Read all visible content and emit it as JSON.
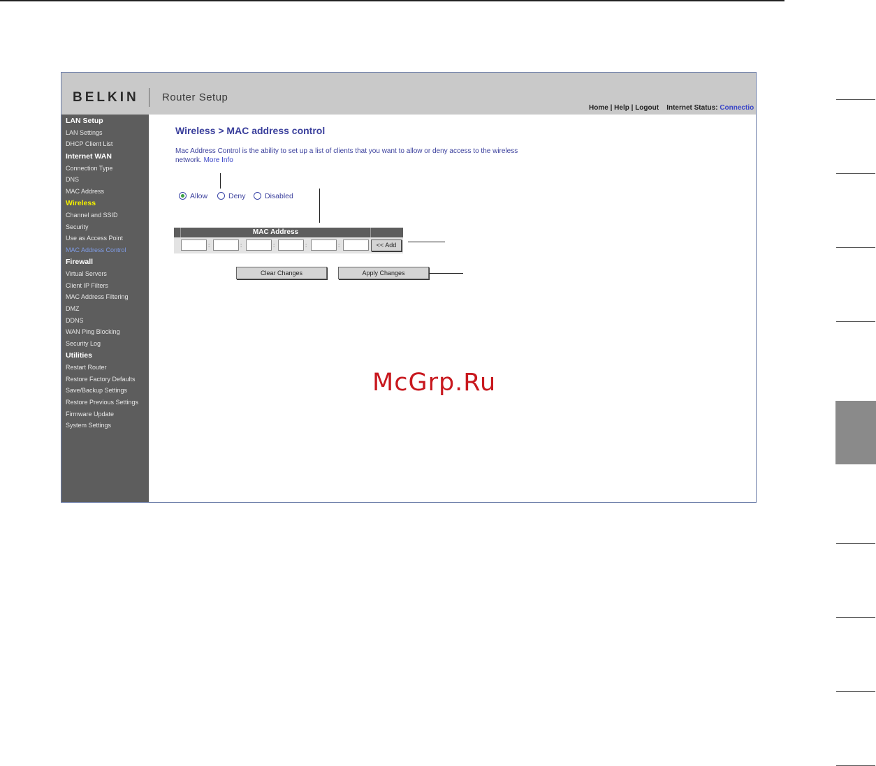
{
  "header": {
    "logo": "BELKIN",
    "title": "Router Setup",
    "links": {
      "home": "Home",
      "help": "Help",
      "logout": "Logout",
      "sep": " | "
    },
    "status_label": "Internet Status:",
    "status_value": "Connectio"
  },
  "sidebar": {
    "items": [
      {
        "label": "LAN Setup",
        "type": "head"
      },
      {
        "label": "LAN Settings",
        "type": "link"
      },
      {
        "label": "DHCP Client List",
        "type": "link"
      },
      {
        "label": "Internet WAN",
        "type": "head"
      },
      {
        "label": "Connection Type",
        "type": "link"
      },
      {
        "label": "DNS",
        "type": "link"
      },
      {
        "label": "MAC Address",
        "type": "link"
      },
      {
        "label": "Wireless",
        "type": "head-active"
      },
      {
        "label": "Channel and SSID",
        "type": "link"
      },
      {
        "label": "Security",
        "type": "link"
      },
      {
        "label": "Use as Access Point",
        "type": "link"
      },
      {
        "label": "MAC Address Control",
        "type": "current"
      },
      {
        "label": "Firewall",
        "type": "head"
      },
      {
        "label": "Virtual Servers",
        "type": "link"
      },
      {
        "label": "Client IP Filters",
        "type": "link"
      },
      {
        "label": "MAC Address Filtering",
        "type": "link"
      },
      {
        "label": "DMZ",
        "type": "link"
      },
      {
        "label": "DDNS",
        "type": "link"
      },
      {
        "label": "WAN Ping Blocking",
        "type": "link"
      },
      {
        "label": "Security Log",
        "type": "link"
      },
      {
        "label": "Utilities",
        "type": "head"
      },
      {
        "label": "Restart Router",
        "type": "link"
      },
      {
        "label": "Restore Factory Defaults",
        "type": "link"
      },
      {
        "label": "Save/Backup Settings",
        "type": "link"
      },
      {
        "label": "Restore Previous Settings",
        "type": "link"
      },
      {
        "label": "Firmware Update",
        "type": "link"
      },
      {
        "label": "System Settings",
        "type": "link"
      }
    ]
  },
  "main": {
    "title": "Wireless > MAC address control",
    "description": "Mac Address Control is the ability to set up a list of clients that you want to allow or deny access to the wireless network.",
    "more_info": "More Info",
    "radios": {
      "allow": "Allow",
      "deny": "Deny",
      "disabled": "Disabled",
      "selected": "allow"
    },
    "mac_table": {
      "header": "MAC Address",
      "separator": ":",
      "octets": [
        "",
        "",
        "",
        "",
        "",
        ""
      ],
      "add_label": "<< Add"
    },
    "clear_label": "Clear Changes",
    "apply_label": "Apply Changes"
  },
  "watermark": "McGrp.Ru",
  "colors": {
    "title_blue": "#3a3f9c",
    "sidebar_bg": "#5d5d5d",
    "header_bg": "#c9c9c9",
    "active_section": "#f4f000",
    "current_item": "#7f9ce6",
    "watermark": "#c8181e"
  }
}
